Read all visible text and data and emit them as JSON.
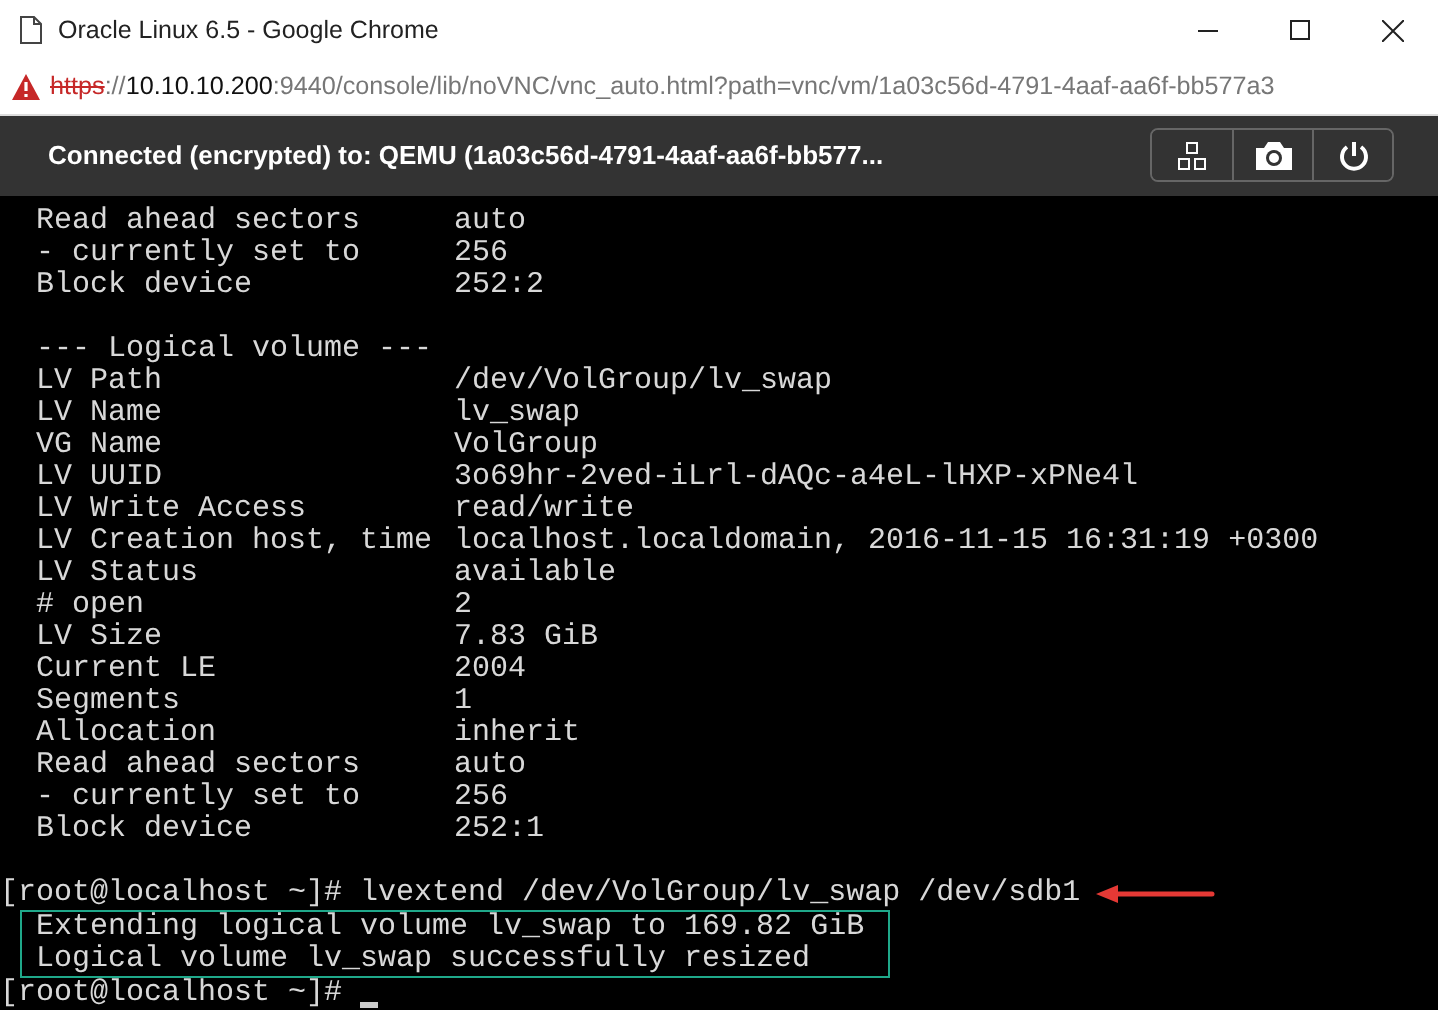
{
  "window": {
    "title": "Oracle Linux 6.5 - Google Chrome"
  },
  "address_bar": {
    "secure": false,
    "scheme": "https",
    "separator": "://",
    "host": "10.10.10.200",
    "path": ":9440/console/lib/noVNC/vnc_auto.html?path=vnc/vm/1a03c56d-4791-4aaf-aa6f-bb577a3"
  },
  "vnc_bar": {
    "status": "Connected (encrypted) to: QEMU (1a03c56d-4791-4aaf-aa6f-bb577..."
  },
  "terminal": {
    "lines": [
      {
        "kind": "field",
        "label": "Read ahead sectors",
        "value": "auto"
      },
      {
        "kind": "field",
        "label": "- currently set to",
        "value": "256"
      },
      {
        "kind": "field",
        "label": "Block device",
        "value": "252:2"
      },
      {
        "kind": "blank"
      },
      {
        "kind": "heading",
        "text": "--- Logical volume ---"
      },
      {
        "kind": "field",
        "label": "LV Path",
        "value": "/dev/VolGroup/lv_swap"
      },
      {
        "kind": "field",
        "label": "LV Name",
        "value": "lv_swap"
      },
      {
        "kind": "field",
        "label": "VG Name",
        "value": "VolGroup"
      },
      {
        "kind": "field",
        "label": "LV UUID",
        "value": "3o69hr-2ved-iLrl-dAQc-a4eL-lHXP-xPNe4l"
      },
      {
        "kind": "field",
        "label": "LV Write Access",
        "value": "read/write"
      },
      {
        "kind": "field",
        "label": "LV Creation host, time",
        "value": "localhost.localdomain, 2016-11-15 16:31:19 +0300"
      },
      {
        "kind": "field",
        "label": "LV Status",
        "value": "available"
      },
      {
        "kind": "field",
        "label": "# open",
        "value": "2"
      },
      {
        "kind": "field",
        "label": "LV Size",
        "value": "7.83 GiB"
      },
      {
        "kind": "field",
        "label": "Current LE",
        "value": "2004"
      },
      {
        "kind": "field",
        "label": "Segments",
        "value": "1"
      },
      {
        "kind": "field",
        "label": "Allocation",
        "value": "inherit"
      },
      {
        "kind": "field",
        "label": "Read ahead sectors",
        "value": "auto"
      },
      {
        "kind": "field",
        "label": "- currently set to",
        "value": "256"
      },
      {
        "kind": "field",
        "label": "Block device",
        "value": "252:1"
      },
      {
        "kind": "blank"
      },
      {
        "kind": "command",
        "prompt": "[root@localhost ~]#",
        "command": "lvextend /dev/VolGroup/lv_swap /dev/sdb1",
        "highlighted": true
      },
      {
        "kind": "output",
        "highlighted": true,
        "text": [
          "Extending logical volume lv_swap to 169.82 GiB",
          "Logical volume lv_swap successfully resized"
        ]
      },
      {
        "kind": "prompt",
        "prompt": "[root@localhost ~]#",
        "cursor": true
      }
    ]
  }
}
